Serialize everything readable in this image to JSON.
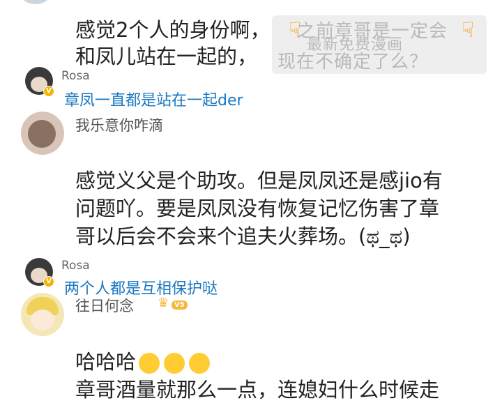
{
  "comment1": {
    "line1": "感觉2个人的身份啊，",
    "line2": "和凤儿站在一起的，"
  },
  "watermark": {
    "line1": "之前章哥是一定会",
    "line2": "最新免费漫画",
    "line3": "现在不确定了么？"
  },
  "reply1": {
    "user": "Rosa",
    "text": "章凤一直都是站在一起der"
  },
  "comment2": {
    "user": "我乐意你咋滴",
    "line1": "感觉义父是个助攻。但是凤凤还是感jio有",
    "line2": "问题吖。要是凤凤没有恢复记忆伤害了章",
    "line3": "哥以后会不会来个追夫火葬场。(ಥ_ಥ)"
  },
  "reply2": {
    "user": "Rosa",
    "text": "两个人都是互相保护哒"
  },
  "comment3": {
    "user": "往日何念",
    "level": "V5",
    "line1": "哈哈哈",
    "line2": "章哥酒量就那么一点，连媳妇什么时候走"
  },
  "icons": {
    "hand": "pointing-hand-icon",
    "emoji": "tears-of-joy-icon",
    "badge": "verified-v-icon"
  },
  "colors": {
    "reply_link": "#1a78c2",
    "badge": "#f2b705"
  }
}
